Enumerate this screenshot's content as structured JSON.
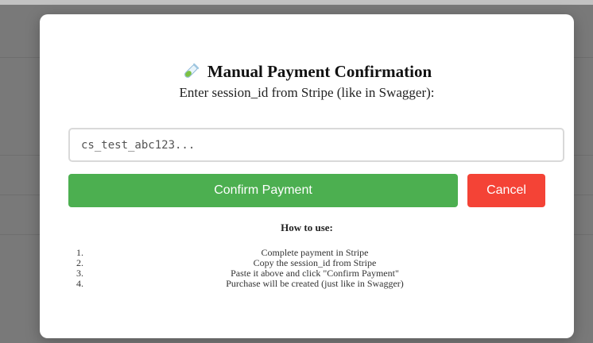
{
  "modal": {
    "icon": "test-tube-icon",
    "title": "Manual Payment Confirmation",
    "subtitle": "Enter session_id from Stripe (like in Swagger):",
    "input_placeholder": "cs_test_abc123...",
    "input_value": "",
    "confirm_label": "Confirm Payment",
    "cancel_label": "Cancel",
    "howto_title": "How to use:",
    "steps": [
      {
        "num": "1.",
        "text": "Complete payment in Stripe"
      },
      {
        "num": "2.",
        "text": "Copy the session_id from Stripe"
      },
      {
        "num": "3.",
        "text": "Paste it above and click \"Confirm Payment\""
      },
      {
        "num": "4.",
        "text": "Purchase will be created (just like in Swagger)"
      }
    ]
  },
  "colors": {
    "confirm": "#4caf50",
    "cancel": "#f44336",
    "overlay": "rgba(0,0,0,0.5)"
  }
}
